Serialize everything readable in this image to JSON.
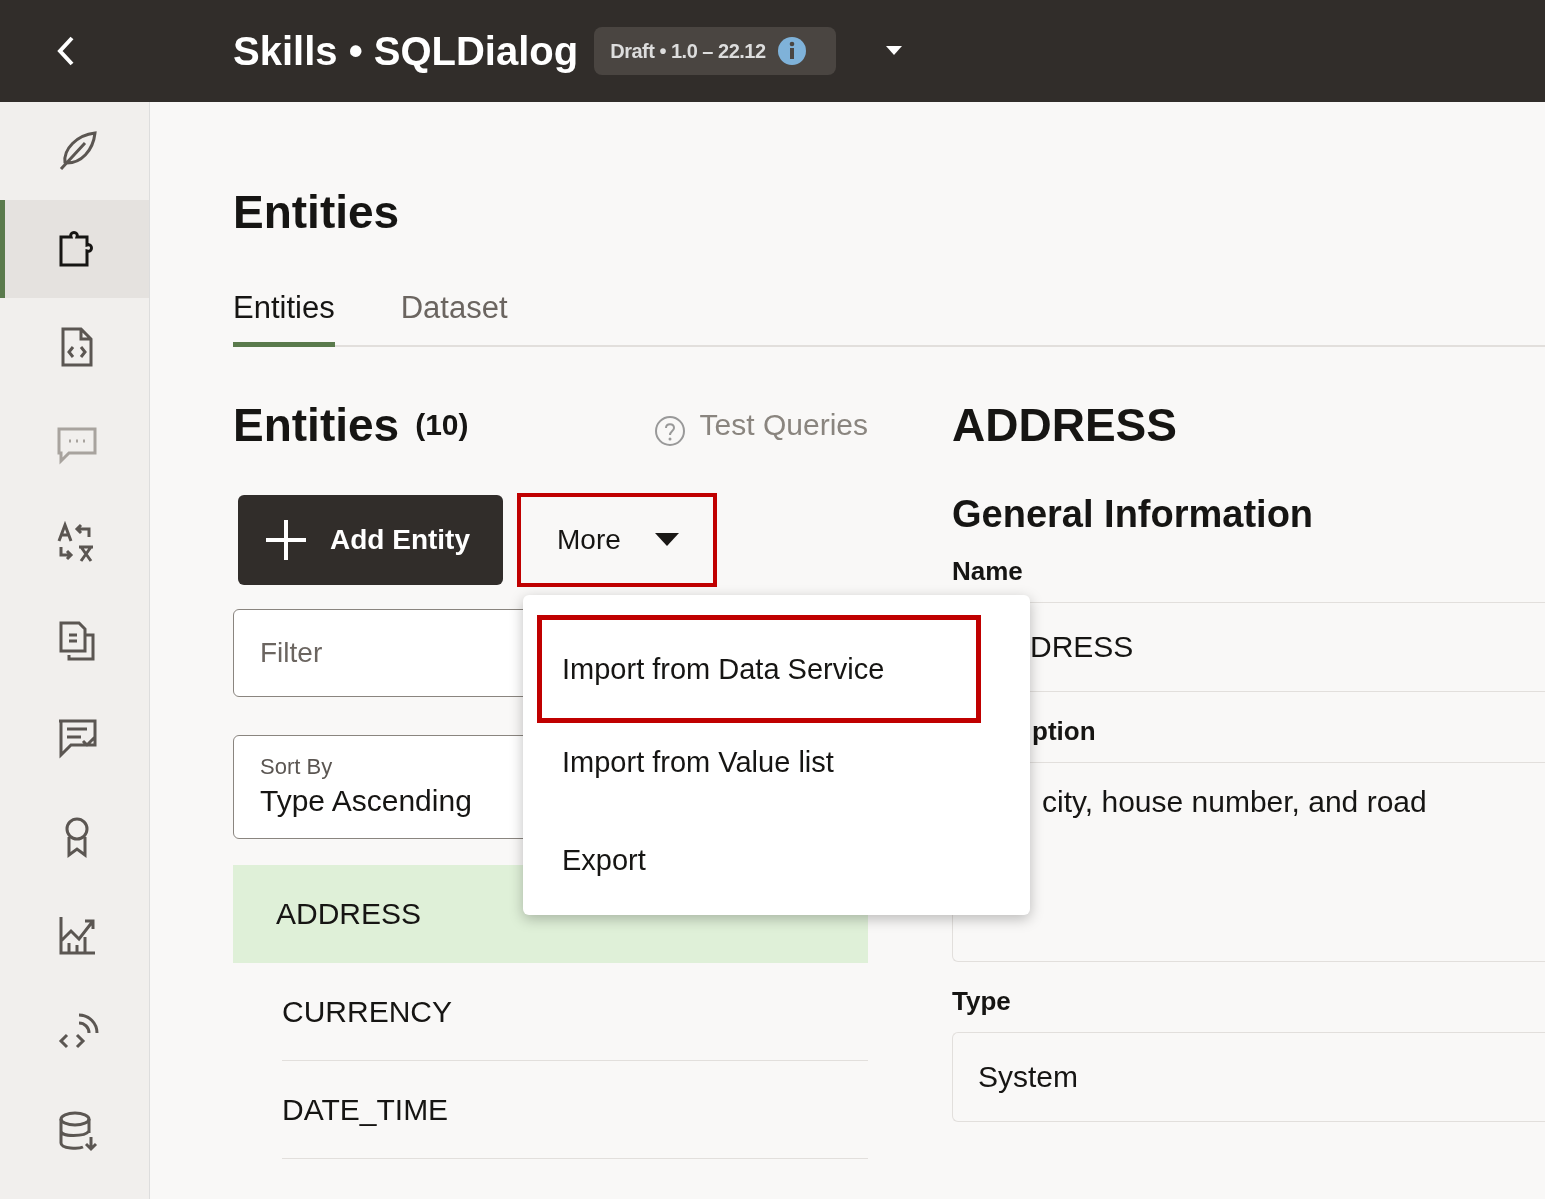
{
  "header": {
    "title": "Skills • SQLDialog",
    "badge": "Draft • 1.0 – 22.12"
  },
  "sidebar": {
    "items": [
      {
        "selected": false,
        "disabled": false
      },
      {
        "selected": true,
        "disabled": false
      },
      {
        "selected": false,
        "disabled": false
      },
      {
        "selected": false,
        "disabled": true
      },
      {
        "selected": false,
        "disabled": false
      },
      {
        "selected": false,
        "disabled": false
      },
      {
        "selected": false,
        "disabled": false
      },
      {
        "selected": false,
        "disabled": false
      },
      {
        "selected": false,
        "disabled": false
      },
      {
        "selected": false,
        "disabled": false
      },
      {
        "selected": false,
        "disabled": false
      }
    ]
  },
  "page_title": "Entities",
  "tabs": [
    {
      "label": "Entities",
      "selected": true
    },
    {
      "label": "Dataset",
      "selected": false
    }
  ],
  "list_panel": {
    "title": "Entities",
    "count": "(10)",
    "test_link": "Test Queries",
    "add_button": "Add Entity",
    "more_button": {
      "label": "More",
      "highlighted": true
    },
    "filter": {
      "placeholder": "Filter"
    },
    "sort": {
      "label": "Sort By",
      "value": "Type Ascending"
    },
    "entities": [
      {
        "name": "ADDRESS",
        "selected": true
      },
      {
        "name": "CURRENCY",
        "selected": false
      },
      {
        "name": "DATE_TIME",
        "selected": false
      }
    ]
  },
  "menu": {
    "items": [
      {
        "label": "Import from Data Service",
        "highlighted": true
      },
      {
        "label": "Import from Value list",
        "highlighted": false
      },
      {
        "label": "Export",
        "highlighted": false
      }
    ]
  },
  "detail": {
    "title": "ADDRESS",
    "section": "General Information",
    "name_label": "Name",
    "name_value": "DRESS",
    "description_label": "ption",
    "description_value": "city, house number, and road",
    "type_label": "Type",
    "type_value": "System"
  }
}
